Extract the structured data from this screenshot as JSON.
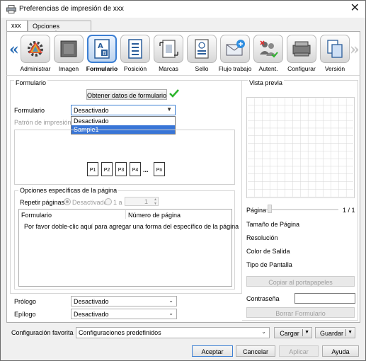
{
  "window": {
    "title": "Preferencias de impresión de xxx",
    "close_glyph": "✕"
  },
  "tabs": [
    "xxx",
    "Opciones avanzadas"
  ],
  "toolbar": {
    "left_arrow": "«",
    "right_arrow": "»",
    "items": [
      {
        "label": "Administrar",
        "icon": "administrar-icon"
      },
      {
        "label": "Imagen",
        "icon": "imagen-icon"
      },
      {
        "label": "Formulario",
        "icon": "formulario-icon",
        "active": true
      },
      {
        "label": "Posición",
        "icon": "posicion-icon"
      },
      {
        "label": "Marcas",
        "icon": "marcas-icon"
      },
      {
        "label": "Sello",
        "icon": "sello-icon"
      },
      {
        "label": "Flujo trabajo",
        "icon": "flujo-trabajo-icon"
      },
      {
        "label": "Autent.",
        "icon": "autent-icon"
      },
      {
        "label": "Configurar",
        "icon": "configurar-icon"
      },
      {
        "label": "Versión",
        "icon": "version-icon"
      }
    ]
  },
  "form": {
    "section_label": "Formulario",
    "get_data_button": "Obtener datos de formulario",
    "form_label": "Formulario",
    "form_value": "Desactivado",
    "dropdown_options": [
      "Desactivado",
      "Sample1"
    ],
    "pattern_label": "Patrón de impresión",
    "pages": [
      "P1",
      "P2",
      "P3",
      "P4",
      "...",
      "Pn"
    ]
  },
  "page_options": {
    "section_label": "Opciones específicas de la página",
    "repeat_label": "Repetir páginas",
    "radio_off": "Desactivado",
    "radio_range": "1 a",
    "spin_value": "1",
    "col_form": "Formulario",
    "col_page": "Número de página",
    "hint": "Por favor doble-clic aquí para agregar una forma del específico de la página"
  },
  "prologue": {
    "label": "Prólogo",
    "value": "Desactivado"
  },
  "epilogue": {
    "label": "Epílogo",
    "value": "Desactivado"
  },
  "preview": {
    "section_label": "Vista previa",
    "page_label": "Página",
    "page_count": "1 / 1",
    "paper_size": "Tamaño de Página",
    "resolution": "Resolución",
    "color_out": "Color de Salida",
    "screen_type": "Tipo de Pantalla",
    "copy_button": "Copiar al portapapeles",
    "password_label": "Contraseña",
    "password_value": "",
    "delete_form_button": "Borrar Formulario"
  },
  "favorites": {
    "label": "Configuración favorita",
    "value": "Configuraciones predefinidos",
    "load_button": "Cargar",
    "save_button": "Guardar"
  },
  "footer": {
    "ok": "Aceptar",
    "cancel": "Cancelar",
    "apply": "Aplicar",
    "help": "Ayuda"
  },
  "colors": {
    "accent": "#3c7fd3",
    "check": "#2db52d",
    "selection": "#3875d7"
  }
}
